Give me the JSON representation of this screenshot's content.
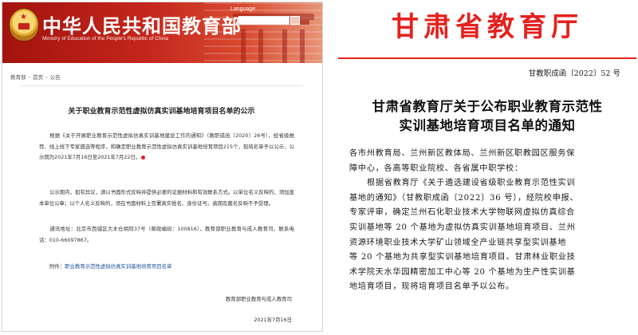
{
  "left": {
    "header_title": "中华人民共和国教育部",
    "header_subtitle": "Ministry of Education of the People's Republic of China",
    "language_link": "Language",
    "breadcrumb": [
      "教育部",
      "首页",
      "公告"
    ],
    "article_title": "关于职业教育示范性虚拟仿真实训基地培育项目名单的公示",
    "para1": "根据《关于开展职业教育示范性虚拟仿真实训基地建设工作的通知》（教职成函〔2020〕26号），经省级推荐、线上线下专家遴选等程序，和确定职业教育示范性虚拟仿真实训基地培育项目215个，现将名单予以公示，公示期为2021年7月16日至2021年7月22日。",
    "para2": "公示期内，如有异议，请以书面形式反映并提供必要的证据材料和有效联系方式。以单位名义反映的，须加盖本单位公章；以个人名义反映的，须在书面材料上签署真实姓名、身份证号。逾期及匿名反映不予受理。",
    "para3": "通讯地址：北京市西城区大木仓胡同37号（邮政编码：100816），教育部职业教育与成人教育司，联系电话：010-66097867。",
    "attachment_label": "附件：",
    "attachment_link": "职业教育示范性虚拟仿真实训基地培育项目名单",
    "signature": "教育部职业教育与成人教育司",
    "date": "2021年7月16日"
  },
  "right": {
    "header": "甘肃省教育厅",
    "doc_number": "甘教职成函〔2022〕52 号",
    "title_line1": "甘肃省教育厅关于公布职业教育示范性",
    "title_line2": "实训基地培育项目名单的通知",
    "body_lines": [
      "各市州教育局、兰州新区教体局、兰州新区职教园区服务保",
      "障中心，各高等职业院校、各省属中职学校：",
      "根据省教育厅《关于遴选建设省级职业教育示范性实训",
      "基地的通知》（甘教职成函〔2022〕36 号），经院校申报、",
      "专家评审，确定兰州石化职业技术大学物联网虚拟仿真综合",
      "实训基地等 20 个基地为虚拟仿真实训基地培育项目、兰州",
      "资源环境职业技术大学矿山领域全产业链共享型实训基地",
      "等 20 个基地为共享型实训基地培育项目、甘肃林业职业技",
      "术学院天水华园精密加工中心等 20 个基地为生产性实训基",
      "地培育项目，现将培育项目名单予以公布。"
    ]
  },
  "colors": {
    "moe_red": "#c4261c",
    "gansu_red": "#e4211e",
    "link_blue": "#1d4f9c"
  }
}
